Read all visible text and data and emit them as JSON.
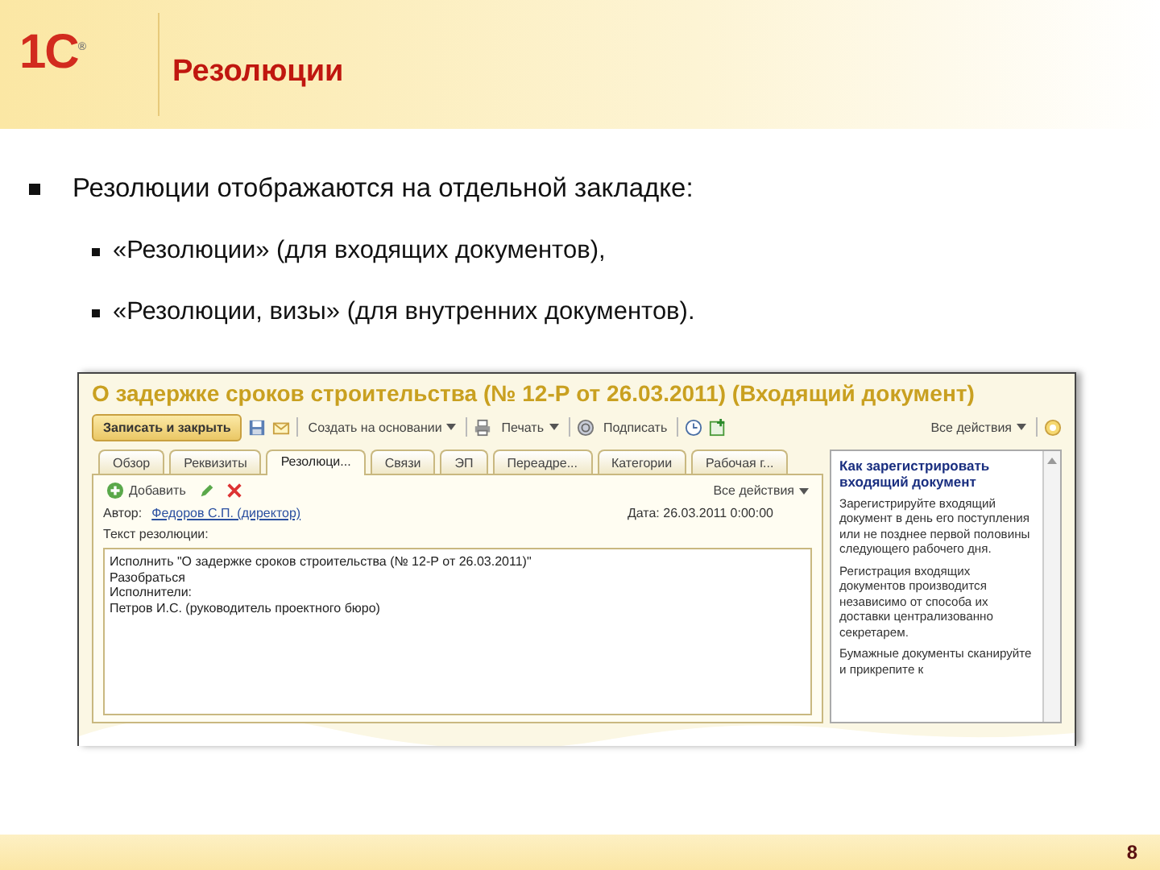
{
  "slide": {
    "logo": "1С",
    "logo_mark": "®",
    "title": "Резолюции",
    "page_number": "8"
  },
  "bullets": [
    {
      "text": "Резолюции отображаются на отдельной закладке:",
      "children": [
        {
          "text": "«Резолюции» (для входящих документов),"
        },
        {
          "text": "«Резолюции, визы» (для внутренних документов)."
        }
      ]
    }
  ],
  "screenshot": {
    "window_title": "О задержке сроков строительства (№ 12-Р от 26.03.2011) (Входящий документ)",
    "toolbar": {
      "primary_button": "Записать и закрыть",
      "create_based_on": "Создать на основании",
      "print": "Печать",
      "sign": "Подписать",
      "all_actions": "Все действия"
    },
    "tabs": [
      {
        "label": "Обзор",
        "selected": false
      },
      {
        "label": "Реквизиты",
        "selected": false
      },
      {
        "label": "Резолюци...",
        "selected": true
      },
      {
        "label": "Связи",
        "selected": false
      },
      {
        "label": "ЭП",
        "selected": false
      },
      {
        "label": "Переадре...",
        "selected": false
      },
      {
        "label": "Категории",
        "selected": false
      },
      {
        "label": "Рабочая г...",
        "selected": false
      }
    ],
    "panel": {
      "add_button": "Добавить",
      "all_actions": "Все действия",
      "author_label": "Автор:",
      "author": "Федоров С.П. (директор)",
      "date": "Дата: 26.03.2011 0:00:00",
      "text_label": "Текст резолюции:",
      "text_value": "Исполнить \"О задержке сроков строительства (№ 12-Р от 26.03.2011)\"\nРазобраться\nИсполнители:\nПетров И.С. (руководитель проектного бюро)"
    },
    "help": {
      "title": "Как зарегистрировать входящий документ",
      "paragraphs": [
        "Зарегистрируйте входящий документ в день его поступления или не позднее первой половины следующего рабочего дня.",
        "Регистрация входящих документов производится независимо от способа их доставки централизованно секретарем.",
        "Бумажные документы сканируйте и прикрепите к"
      ]
    }
  }
}
